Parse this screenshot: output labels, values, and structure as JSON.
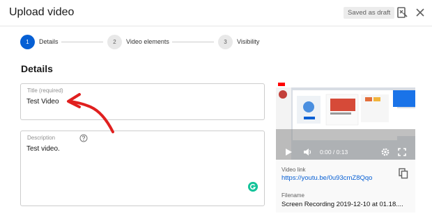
{
  "dialog": {
    "title": "Upload video",
    "draft_badge": "Saved as draft"
  },
  "stepper": {
    "steps": [
      {
        "number": "1",
        "label": "Details",
        "active": true
      },
      {
        "number": "2",
        "label": "Video elements",
        "active": false
      },
      {
        "number": "3",
        "label": "Visibility",
        "active": false
      }
    ]
  },
  "details": {
    "heading": "Details",
    "title_field": {
      "label": "Title (required)",
      "value": "Test Video"
    },
    "description_field": {
      "label": "Description",
      "value": "Test video."
    }
  },
  "video": {
    "time": "0:00 / 0:13",
    "link_label": "Video link",
    "link": "https://youtu.be/0u93cmZ8Qqo",
    "filename_label": "Filename",
    "filename": "Screen Recording 2019-12-10 at 01.18...."
  },
  "colors": {
    "accent": "#065fd4",
    "annotation": "#e0201f",
    "grammarly": "#15c39a"
  },
  "icons": [
    "feedback-icon",
    "close-icon",
    "help-icon",
    "grammarly-icon",
    "play-icon",
    "volume-icon",
    "settings-icon",
    "fullscreen-icon",
    "copy-icon"
  ]
}
